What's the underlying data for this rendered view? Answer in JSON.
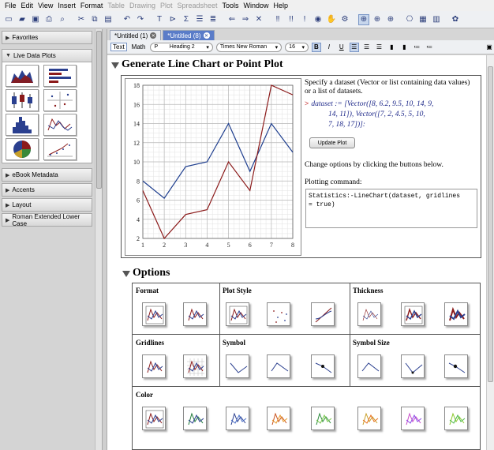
{
  "menu": [
    "File",
    "Edit",
    "View",
    "Insert",
    "Format",
    "Table",
    "Drawing",
    "Plot",
    "Spreadsheet",
    "Tools",
    "Window",
    "Help"
  ],
  "menu_disabled": [
    "Table",
    "Drawing",
    "Plot",
    "Spreadsheet"
  ],
  "palettes": {
    "favorites": "Favorites",
    "live_data_plots": "Live Data Plots",
    "ebook_metadata": "eBook Metadata",
    "accents": "Accents",
    "layout": "Layout",
    "roman_extended": "Roman Extended Lower Case"
  },
  "tabs": [
    {
      "label": "*Untitled (1)"
    },
    {
      "label": "*Untitled (8)"
    }
  ],
  "context": {
    "text_mode": "Text",
    "math_mode": "Math",
    "style": "Heading 2",
    "font": "Times New Roman",
    "size": "16",
    "bold": "B",
    "italic": "I",
    "underline": "U"
  },
  "document": {
    "section1_title": "Generate Line Chart or Point Plot",
    "description_line1": "Specify a dataset (Vector or list containing data values)",
    "description_line2": "or a list of datasets.",
    "math_line1": "dataset := [Vector([8, 6.2, 9.5, 10, 14, 9,",
    "math_line2": "14, 11]), Vector([7, 2, 4.5, 5, 10,",
    "math_line3": "7, 18, 17])]:",
    "update_button": "Update Plot",
    "change_text": "Change options by clicking the buttons below.",
    "plotting_label": "Plotting command:",
    "command_line1": "Statistics:-LineChart(dataset, gridlines",
    "command_line2": "= true)",
    "section2_title": "Options",
    "options_headers": {
      "format": "Format",
      "plot_style": "Plot Style",
      "thickness": "Thickness",
      "gridlines": "Gridlines",
      "symbol": "Symbol",
      "symbol_size": "Symbol Size",
      "color": "Color"
    }
  },
  "colors": {
    "series1": "#1f3f8f",
    "series2": "#8b1a1a",
    "accent": "#5a7cc8"
  },
  "chart_data": {
    "type": "line",
    "x": [
      1,
      2,
      3,
      4,
      5,
      6,
      7,
      8
    ],
    "series": [
      {
        "values": [
          8,
          6.2,
          9.5,
          10,
          14,
          9,
          14,
          11
        ]
      },
      {
        "values": [
          7,
          2,
          4.5,
          5,
          10,
          7,
          18,
          17
        ]
      }
    ],
    "xlim": [
      1,
      8
    ],
    "ylim": [
      2,
      18
    ],
    "xticks": [
      1,
      2,
      3,
      4,
      5,
      6,
      7,
      8
    ],
    "yticks": [
      2,
      4,
      6,
      8,
      10,
      12,
      14,
      16,
      18
    ],
    "grid": true
  }
}
